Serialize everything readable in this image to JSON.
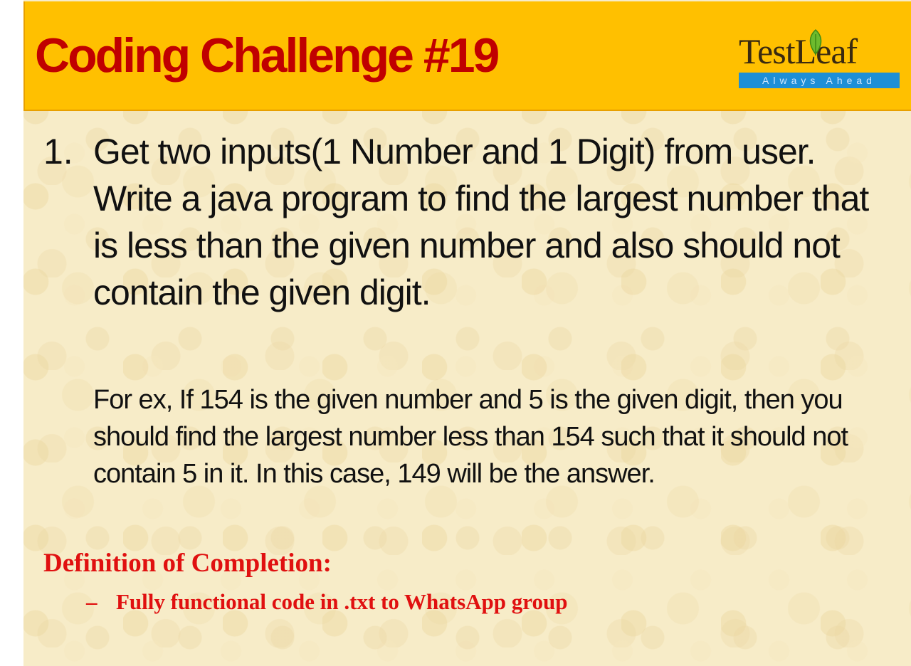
{
  "header": {
    "title": "Coding Challenge #19",
    "logo": {
      "wordmark": "TestLeaf",
      "tagline": "Always Ahead",
      "icon": "leaf-icon"
    }
  },
  "question": {
    "number": "1.",
    "text": "Get two inputs(1 Number and 1 Digit) from user. Write a java program to find the largest number that is less than the given number and also should not contain the given digit.",
    "example": "For ex, If 154 is the given number and 5 is the given digit, then you should find the largest number less than 154 such that it should not contain 5 in it. In this case, 149 will be the answer."
  },
  "definition_of_completion": {
    "heading": "Definition of Completion:",
    "items": [
      {
        "bullet": "–",
        "text": "Fully functional code in .txt to WhatsApp group"
      }
    ]
  },
  "colors": {
    "header_band": "#ffc000",
    "title": "#c00000",
    "definition_text": "#e01010",
    "background": "#f7ecc8",
    "logo_tagline_bg": "#1e8fd6"
  }
}
